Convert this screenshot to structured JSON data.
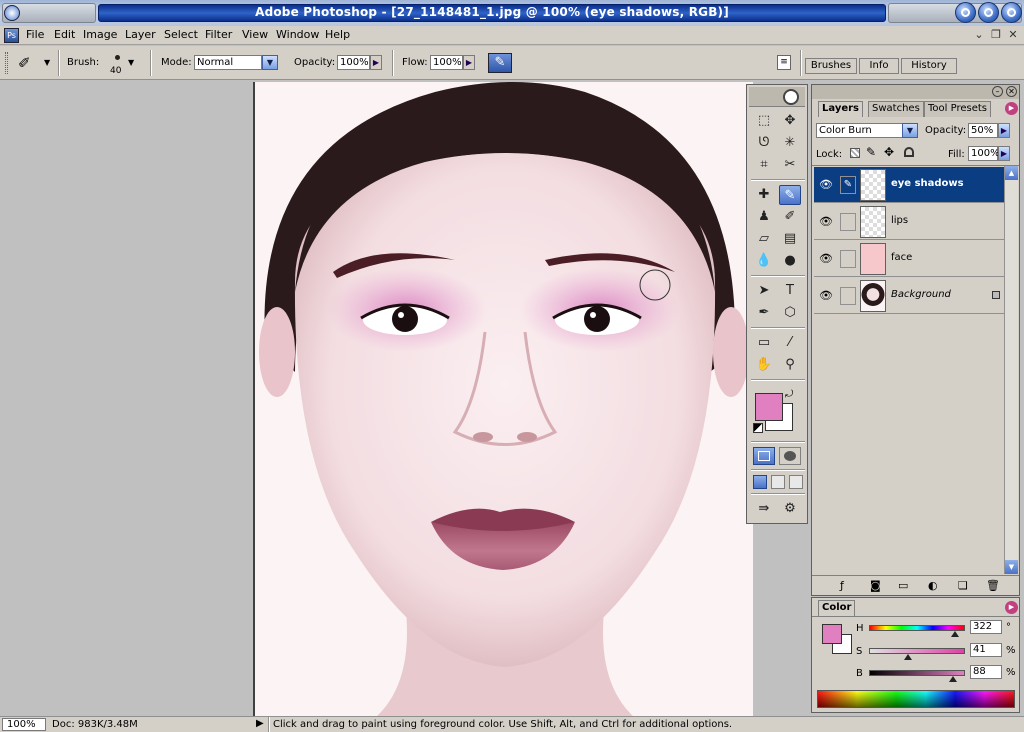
{
  "window": {
    "title": "Adobe Photoshop - [27_1148481_1.jpg @ 100% (eye shadows, RGB)]"
  },
  "menu": [
    "File",
    "Edit",
    "Image",
    "Layer",
    "Select",
    "Filter",
    "View",
    "Window",
    "Help"
  ],
  "options": {
    "brush_label": "Brush:",
    "brush_size": "40",
    "mode_label": "Mode:",
    "mode_value": "Normal",
    "opacity_label": "Opacity:",
    "opacity_value": "100%",
    "flow_label": "Flow:",
    "flow_value": "100%"
  },
  "palette_well": [
    "Brushes",
    "Info",
    "History"
  ],
  "layers_palette": {
    "tabs": [
      "Layers",
      "Swatches",
      "Tool Presets"
    ],
    "blend_mode": "Color Burn",
    "opacity_label": "Opacity:",
    "opacity_value": "50%",
    "lock_label": "Lock:",
    "fill_label": "Fill:",
    "fill_value": "100%",
    "layers": [
      {
        "name": "eye shadows",
        "selected": true
      },
      {
        "name": "lips",
        "selected": false
      },
      {
        "name": "face",
        "selected": false
      },
      {
        "name": "Background",
        "selected": false,
        "locked": true
      }
    ]
  },
  "color_palette": {
    "tab": "Color",
    "h_label": "H",
    "h_value": "322",
    "h_unit": "°",
    "s_label": "S",
    "s_value": "41",
    "s_unit": "%",
    "b_label": "B",
    "b_value": "88",
    "b_unit": "%",
    "h_fraction": 0.894,
    "s_fraction": 0.41,
    "b_fraction": 0.88
  },
  "colors": {
    "foreground": "#e080c0",
    "background": "#ffffff",
    "selection": "#0a3d82"
  },
  "status": {
    "zoom": "100%",
    "doc": "Doc: 983K/3.48M",
    "hint": "Click and drag to paint using foreground color.  Use Shift, Alt, and Ctrl for additional options."
  }
}
